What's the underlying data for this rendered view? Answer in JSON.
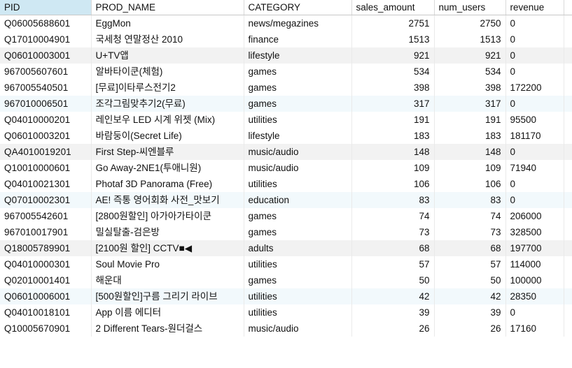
{
  "table": {
    "columns": [
      {
        "key": "pid",
        "label": "PID",
        "align": "left",
        "selected": true
      },
      {
        "key": "prod_name",
        "label": "PROD_NAME",
        "align": "left",
        "selected": false
      },
      {
        "key": "category",
        "label": "CATEGORY",
        "align": "left",
        "selected": false
      },
      {
        "key": "sales_amount",
        "label": "sales_amount",
        "align": "right",
        "selected": false
      },
      {
        "key": "num_users",
        "label": "num_users",
        "align": "right",
        "selected": false
      },
      {
        "key": "revenue",
        "label": "revenue",
        "align": "left",
        "selected": false
      }
    ],
    "rows": [
      {
        "pid": "Q06005688601",
        "prod_name": "EggMon",
        "category": "news/megazines",
        "sales_amount": "2751",
        "num_users": "2750",
        "revenue": "0",
        "band": "white"
      },
      {
        "pid": "Q17010004901",
        "prod_name": "국세청 연말정산 2010",
        "category": "finance",
        "sales_amount": "1513",
        "num_users": "1513",
        "revenue": "0",
        "band": "white"
      },
      {
        "pid": "Q06010003001",
        "prod_name": "U+TV앱",
        "category": "lifestyle",
        "sales_amount": "921",
        "num_users": "921",
        "revenue": "0",
        "band": "gray"
      },
      {
        "pid": "967005607601",
        "prod_name": "알바타이쿤(체험)",
        "category": "games",
        "sales_amount": "534",
        "num_users": "534",
        "revenue": "0",
        "band": "white"
      },
      {
        "pid": "967005540501",
        "prod_name": "[무료]이타루스전기2",
        "category": "games",
        "sales_amount": "398",
        "num_users": "398",
        "revenue": "172200",
        "band": "white"
      },
      {
        "pid": "967010006501",
        "prod_name": "조각그림맞추기2(무료)",
        "category": "games",
        "sales_amount": "317",
        "num_users": "317",
        "revenue": "0",
        "band": "blue"
      },
      {
        "pid": "Q04010000201",
        "prod_name": "레인보우 LED 시계 위젯 (Mix)",
        "category": "utilities",
        "sales_amount": "191",
        "num_users": "191",
        "revenue": "95500",
        "band": "white"
      },
      {
        "pid": "Q06010003201",
        "prod_name": "바람둥이(Secret Life)",
        "category": "lifestyle",
        "sales_amount": "183",
        "num_users": "183",
        "revenue": "181170",
        "band": "white"
      },
      {
        "pid": "QA4010019201",
        "prod_name": "First Step-씨엔블루",
        "category": "music/audio",
        "sales_amount": "148",
        "num_users": "148",
        "revenue": "0",
        "band": "gray"
      },
      {
        "pid": "Q10010000601",
        "prod_name": "Go Away-2NE1(투애니원)",
        "category": "music/audio",
        "sales_amount": "109",
        "num_users": "109",
        "revenue": "71940",
        "band": "white"
      },
      {
        "pid": "Q04010021301",
        "prod_name": "Photaf 3D Panorama (Free)",
        "category": "utilities",
        "sales_amount": "106",
        "num_users": "106",
        "revenue": "0",
        "band": "white"
      },
      {
        "pid": "Q07010002301",
        "prod_name": "AE! 즉통 영어회화 사전_맛보기",
        "category": "education",
        "sales_amount": "83",
        "num_users": "83",
        "revenue": "0",
        "band": "blue"
      },
      {
        "pid": "967005542601",
        "prod_name": "[2800원할인] 아가아가타이쿤",
        "category": "games",
        "sales_amount": "74",
        "num_users": "74",
        "revenue": "206000",
        "band": "white"
      },
      {
        "pid": "967010017901",
        "prod_name": "밀실탈출-검은방",
        "category": "games",
        "sales_amount": "73",
        "num_users": "73",
        "revenue": "328500",
        "band": "white"
      },
      {
        "pid": "Q18005789901",
        "prod_name": "[2100원 할인] CCTV■◀",
        "category": "adults",
        "sales_amount": "68",
        "num_users": "68",
        "revenue": "197700",
        "band": "gray"
      },
      {
        "pid": "Q04010000301",
        "prod_name": "Soul Movie Pro",
        "category": "utilities",
        "sales_amount": "57",
        "num_users": "57",
        "revenue": "114000",
        "band": "white"
      },
      {
        "pid": "Q02010001401",
        "prod_name": "해운대",
        "category": "games",
        "sales_amount": "50",
        "num_users": "50",
        "revenue": "100000",
        "band": "white"
      },
      {
        "pid": "Q06010006001",
        "prod_name": "[500원할인]구름 그리기 라이브",
        "category": "utilities",
        "sales_amount": "42",
        "num_users": "42",
        "revenue": "28350",
        "band": "blue"
      },
      {
        "pid": "Q04010018101",
        "prod_name": "App 이름 에디터",
        "category": "utilities",
        "sales_amount": "39",
        "num_users": "39",
        "revenue": "0",
        "band": "white"
      },
      {
        "pid": "Q10005670901",
        "prod_name": "2 Different Tears-원더걸스",
        "category": "music/audio",
        "sales_amount": "26",
        "num_users": "26",
        "revenue": "17160",
        "band": "white"
      }
    ]
  }
}
